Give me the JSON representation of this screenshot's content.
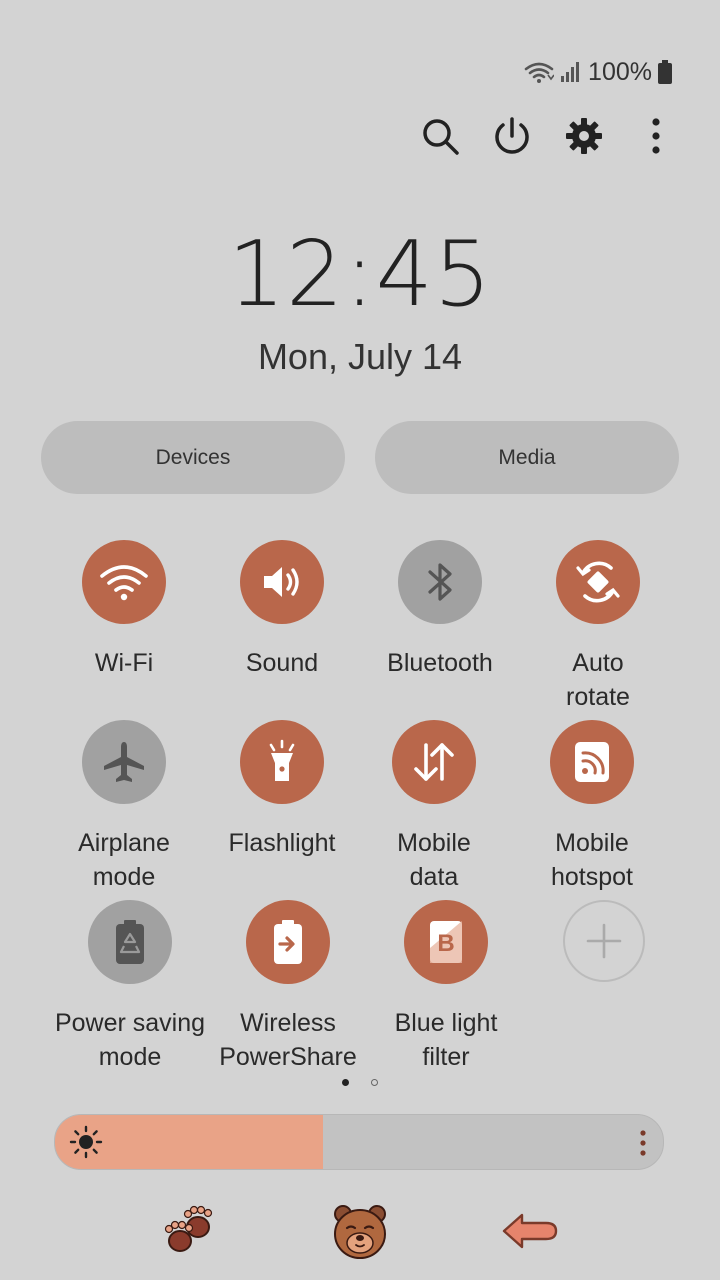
{
  "status_bar": {
    "battery_percent": "100%",
    "icons": [
      "wifi-icon",
      "signal-icon",
      "battery-icon"
    ]
  },
  "header_actions": [
    {
      "name": "search-icon"
    },
    {
      "name": "power-icon"
    },
    {
      "name": "settings-icon"
    },
    {
      "name": "more-options-icon"
    }
  ],
  "clock": {
    "time": "12:45",
    "date": "Mon, July 14"
  },
  "pills": {
    "devices": "Devices",
    "media": "Media"
  },
  "tiles": [
    {
      "label": "Wi-Fi",
      "icon": "wifi-icon",
      "on": true
    },
    {
      "label": "Sound",
      "icon": "sound-icon",
      "on": true
    },
    {
      "label": "Bluetooth",
      "icon": "bluetooth-icon",
      "on": false
    },
    {
      "label": "Auto\nrotate",
      "icon": "auto-rotate-icon",
      "on": true
    },
    {
      "label": "Airplane\nmode",
      "icon": "airplane-icon",
      "on": false
    },
    {
      "label": "Flashlight",
      "icon": "flashlight-icon",
      "on": true
    },
    {
      "label": "Mobile\ndata",
      "icon": "mobile-data-icon",
      "on": true
    },
    {
      "label": "Mobile\nhotspot",
      "icon": "hotspot-icon",
      "on": true
    },
    {
      "label": "Power saving\nmode",
      "icon": "power-saving-icon",
      "on": false
    },
    {
      "label": "Wireless\nPowerShare",
      "icon": "wireless-powershare-icon",
      "on": true
    },
    {
      "label": "Blue light\nfilter",
      "icon": "blue-light-filter-icon",
      "on": true
    },
    {
      "label": "",
      "icon": "add-tile-icon",
      "on": false
    }
  ],
  "pager": {
    "pages": 2,
    "current": 1
  },
  "brightness": {
    "level": 0.44
  },
  "nav_bar": [
    "paw-print-icon",
    "bear-face-icon",
    "back-arrow-icon"
  ],
  "colors": {
    "accent_on": "#b9674b",
    "tile_off": "#a1a1a1",
    "background": "#d3d3d3",
    "brightness_fill": "#e9a387"
  }
}
